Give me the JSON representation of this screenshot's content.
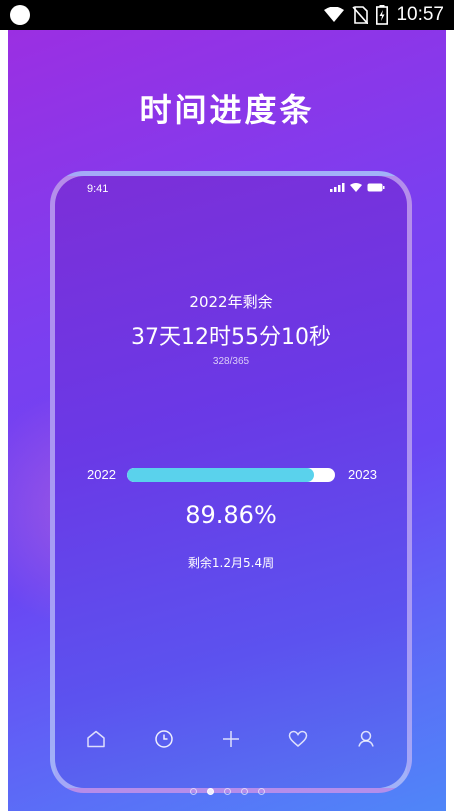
{
  "status_bar": {
    "time": "10:57",
    "icons": [
      "circle-dot-icon",
      "wifi-icon",
      "no-sim-icon",
      "battery-charging-icon"
    ]
  },
  "banner": {
    "title": "时间进度条"
  },
  "phone": {
    "status_time": "9:41",
    "status_icons": [
      "signal-icon",
      "wifi-icon",
      "battery-icon"
    ],
    "remaining_label": "2022年剩余",
    "remaining_value": "37天12时55分10秒",
    "day_count": "328/365",
    "progress": {
      "start_year": "2022",
      "end_year": "2023",
      "percent_value": 89.86,
      "percent_text": "89.86%"
    },
    "remaining_months": "剩余1.2月5.4周",
    "tabs": [
      "home-icon",
      "clock-icon",
      "plus-icon",
      "heart-icon",
      "profile-icon"
    ]
  },
  "pager": {
    "count": 5,
    "active_index": 1
  },
  "colors": {
    "gradient_start": "#9b2fe2",
    "gradient_end": "#4f86f8",
    "progress_fill": "#5ad2ec",
    "progress_track": "#ffffff"
  }
}
